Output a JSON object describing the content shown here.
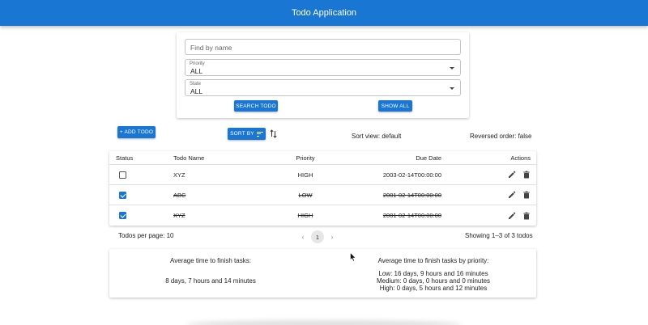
{
  "appbar": {
    "title": "Todo Application"
  },
  "filters": {
    "name_placeholder": "Find by name",
    "priority_label": "Priority",
    "priority_value": "ALL",
    "state_label": "State",
    "state_value": "ALL",
    "search_label": "Search Todo",
    "showall_label": "Show All"
  },
  "toolbar": {
    "add_label": "+ Add Todo",
    "sort_label": "Sort By",
    "sort_view": "Sort view: default",
    "reversed": "Reversed order: false"
  },
  "table": {
    "headers": {
      "status": "Status",
      "name": "Todo Name",
      "priority": "Priority",
      "due": "Due Date",
      "actions": "Actions"
    },
    "rows": [
      {
        "name": "XYZ",
        "priority": "HIGH",
        "due": "2003-02-14T00:00:00",
        "done": false
      },
      {
        "name": "ABC",
        "priority": "LOW",
        "due": "2001-02-14T00:00:00",
        "done": true
      },
      {
        "name": "XYZ",
        "priority": "HIGH",
        "due": "2001-02-14T00:00:00",
        "done": true
      }
    ]
  },
  "pagination": {
    "per_page": "Todos per page: 10",
    "current_page": "1",
    "showing": "Showing 1–3 of 3 todos"
  },
  "stats": {
    "avg_label": "Average time to finish tasks:",
    "avg_value": "8 days, 7 hours and 14 minutes",
    "prio_label": "Average time to finish tasks by priority:",
    "low": "Low: 16 days, 9 hours and 16 minutes",
    "medium": "Medium: 0 days, 0 hours and 0 minutes",
    "high": "High: 0 days, 5 hours and 12 minutes"
  },
  "icons": {
    "edit": "pencil-icon",
    "delete": "trash-icon",
    "sort": "sort-lines-icon",
    "swap": "swap-vertical-icon"
  },
  "colors": {
    "primary": "#1976d2"
  }
}
